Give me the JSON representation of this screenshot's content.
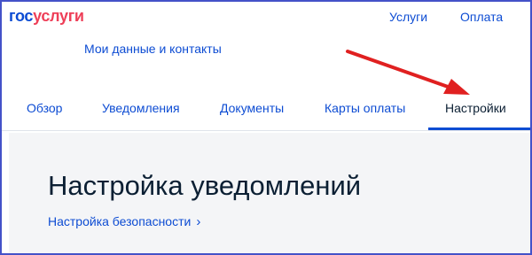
{
  "logo": {
    "part1": "гос",
    "part2": "услуги"
  },
  "topnav": {
    "services": "Услуги",
    "payment": "Оплата"
  },
  "profile_link": "Мои данные и контакты",
  "tabs": [
    {
      "label": "Обзор"
    },
    {
      "label": "Уведомления"
    },
    {
      "label": "Документы"
    },
    {
      "label": "Карты оплаты"
    },
    {
      "label": "Настройки",
      "active": true
    }
  ],
  "main": {
    "title": "Настройка уведомлений",
    "security_link": "Настройка безопасности",
    "security_chevron": "›"
  },
  "colors": {
    "accent": "#0d4cd3",
    "logo_red": "#ee3f58",
    "arrow": "#e02020",
    "frame": "#4452c8"
  }
}
